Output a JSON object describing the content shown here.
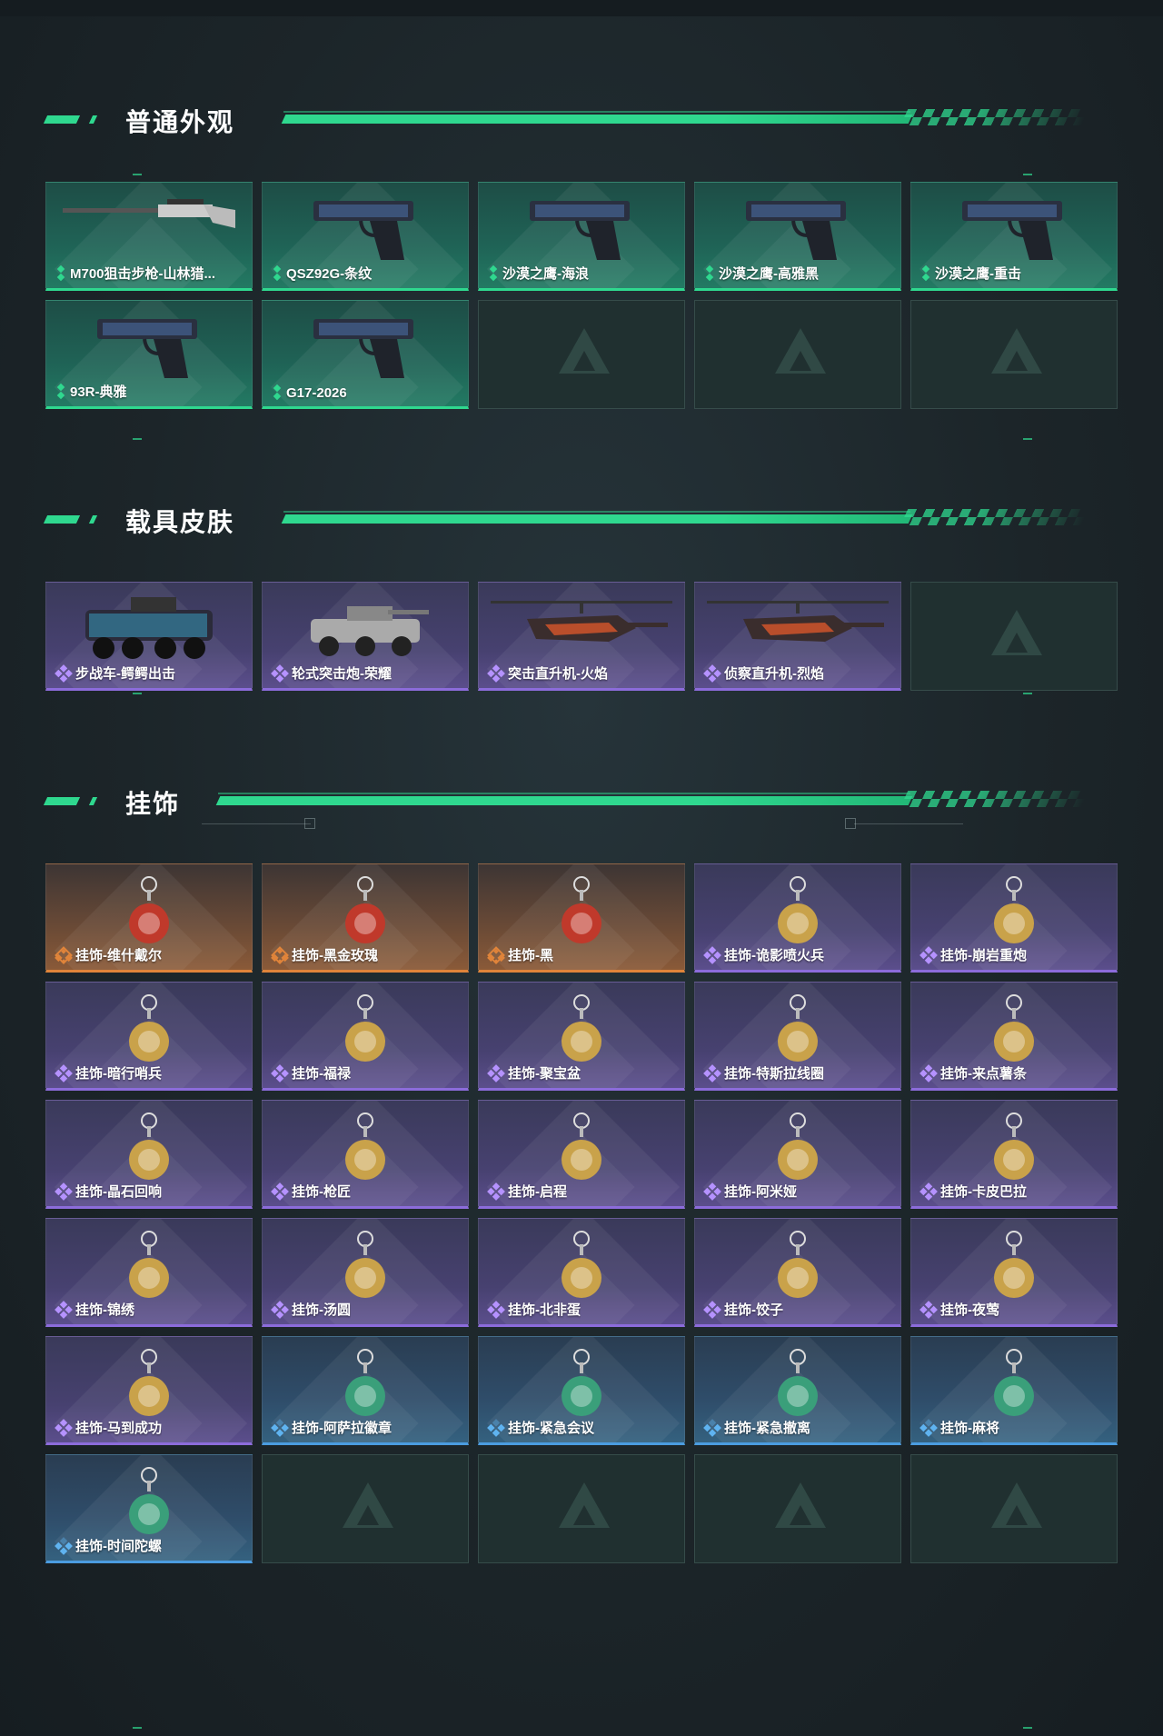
{
  "sections": [
    {
      "title": "普通外观",
      "items": [
        {
          "label": "M700狙击步枪-山林猎...",
          "rarity": "green",
          "icon": "sniper-rifle-icon"
        },
        {
          "label": "QSZ92G-条纹",
          "rarity": "green",
          "icon": "pistol-icon"
        },
        {
          "label": "沙漠之鹰-海浪",
          "rarity": "green",
          "icon": "pistol-icon"
        },
        {
          "label": "沙漠之鹰-高雅黑",
          "rarity": "green",
          "icon": "pistol-icon"
        },
        {
          "label": "沙漠之鹰-重击",
          "rarity": "green",
          "icon": "pistol-icon"
        },
        {
          "label": "93R-典雅",
          "rarity": "green",
          "icon": "pistol-icon"
        },
        {
          "label": "G17-2026",
          "rarity": "green",
          "icon": "pistol-icon"
        },
        {
          "label": "",
          "rarity": "empty"
        },
        {
          "label": "",
          "rarity": "empty"
        },
        {
          "label": "",
          "rarity": "empty"
        }
      ]
    },
    {
      "title": "载具皮肤",
      "items": [
        {
          "label": "步战车-鳄鳄出击",
          "rarity": "purple",
          "icon": "armored-vehicle-icon"
        },
        {
          "label": "轮式突击炮-荣耀",
          "rarity": "purple",
          "icon": "assault-gun-icon"
        },
        {
          "label": "突击直升机-火焰",
          "rarity": "purple",
          "icon": "helicopter-icon"
        },
        {
          "label": "侦察直升机-烈焰",
          "rarity": "purple",
          "icon": "helicopter-icon"
        },
        {
          "label": "",
          "rarity": "empty"
        }
      ]
    },
    {
      "title": "挂饰",
      "items": [
        {
          "label": "挂饰-维什戴尔",
          "rarity": "orange",
          "icon": "charm-icon"
        },
        {
          "label": "挂饰-黑金玫瑰",
          "rarity": "orange",
          "icon": "charm-icon"
        },
        {
          "label": "挂饰-黑",
          "rarity": "orange",
          "icon": "charm-icon"
        },
        {
          "label": "挂饰-诡影喷火兵",
          "rarity": "purple",
          "icon": "charm-icon"
        },
        {
          "label": "挂饰-崩岩重炮",
          "rarity": "purple",
          "icon": "charm-icon"
        },
        {
          "label": "挂饰-暗行哨兵",
          "rarity": "purple",
          "icon": "charm-icon"
        },
        {
          "label": "挂饰-福禄",
          "rarity": "purple",
          "icon": "charm-icon"
        },
        {
          "label": "挂饰-聚宝盆",
          "rarity": "purple",
          "icon": "charm-icon"
        },
        {
          "label": "挂饰-特斯拉线圈",
          "rarity": "purple",
          "icon": "charm-icon"
        },
        {
          "label": "挂饰-来点薯条",
          "rarity": "purple",
          "icon": "charm-icon"
        },
        {
          "label": "挂饰-晶石回响",
          "rarity": "purple",
          "icon": "charm-icon"
        },
        {
          "label": "挂饰-枪匠",
          "rarity": "purple",
          "icon": "charm-icon"
        },
        {
          "label": "挂饰-启程",
          "rarity": "purple",
          "icon": "charm-icon"
        },
        {
          "label": "挂饰-阿米娅",
          "rarity": "purple",
          "icon": "charm-icon"
        },
        {
          "label": "挂饰-卡皮巴拉",
          "rarity": "purple",
          "icon": "charm-icon"
        },
        {
          "label": "挂饰-锦绣",
          "rarity": "purple",
          "icon": "charm-icon"
        },
        {
          "label": "挂饰-汤圆",
          "rarity": "purple",
          "icon": "charm-icon"
        },
        {
          "label": "挂饰-北非蛋",
          "rarity": "purple",
          "icon": "charm-icon"
        },
        {
          "label": "挂饰-饺子",
          "rarity": "purple",
          "icon": "charm-icon"
        },
        {
          "label": "挂饰-夜莺",
          "rarity": "purple",
          "icon": "charm-icon"
        },
        {
          "label": "挂饰-马到成功",
          "rarity": "purple",
          "icon": "charm-icon"
        },
        {
          "label": "挂饰-阿萨拉徽章",
          "rarity": "blue",
          "icon": "charm-icon"
        },
        {
          "label": "挂饰-紧急会议",
          "rarity": "blue",
          "icon": "charm-icon"
        },
        {
          "label": "挂饰-紧急撤离",
          "rarity": "blue",
          "icon": "charm-icon"
        },
        {
          "label": "挂饰-麻将",
          "rarity": "blue",
          "icon": "charm-icon"
        },
        {
          "label": "挂饰-时间陀螺",
          "rarity": "blue",
          "icon": "charm-icon"
        },
        {
          "label": "",
          "rarity": "empty"
        },
        {
          "label": "",
          "rarity": "empty"
        },
        {
          "label": "",
          "rarity": "empty"
        },
        {
          "label": "",
          "rarity": "empty"
        }
      ]
    }
  ],
  "colors": {
    "accent": "#2fd88f",
    "green_rarity": "#2fd88f",
    "purple_rarity": "#8c6cdb",
    "orange_rarity": "#e0843a",
    "blue_rarity": "#4b9ce0"
  }
}
